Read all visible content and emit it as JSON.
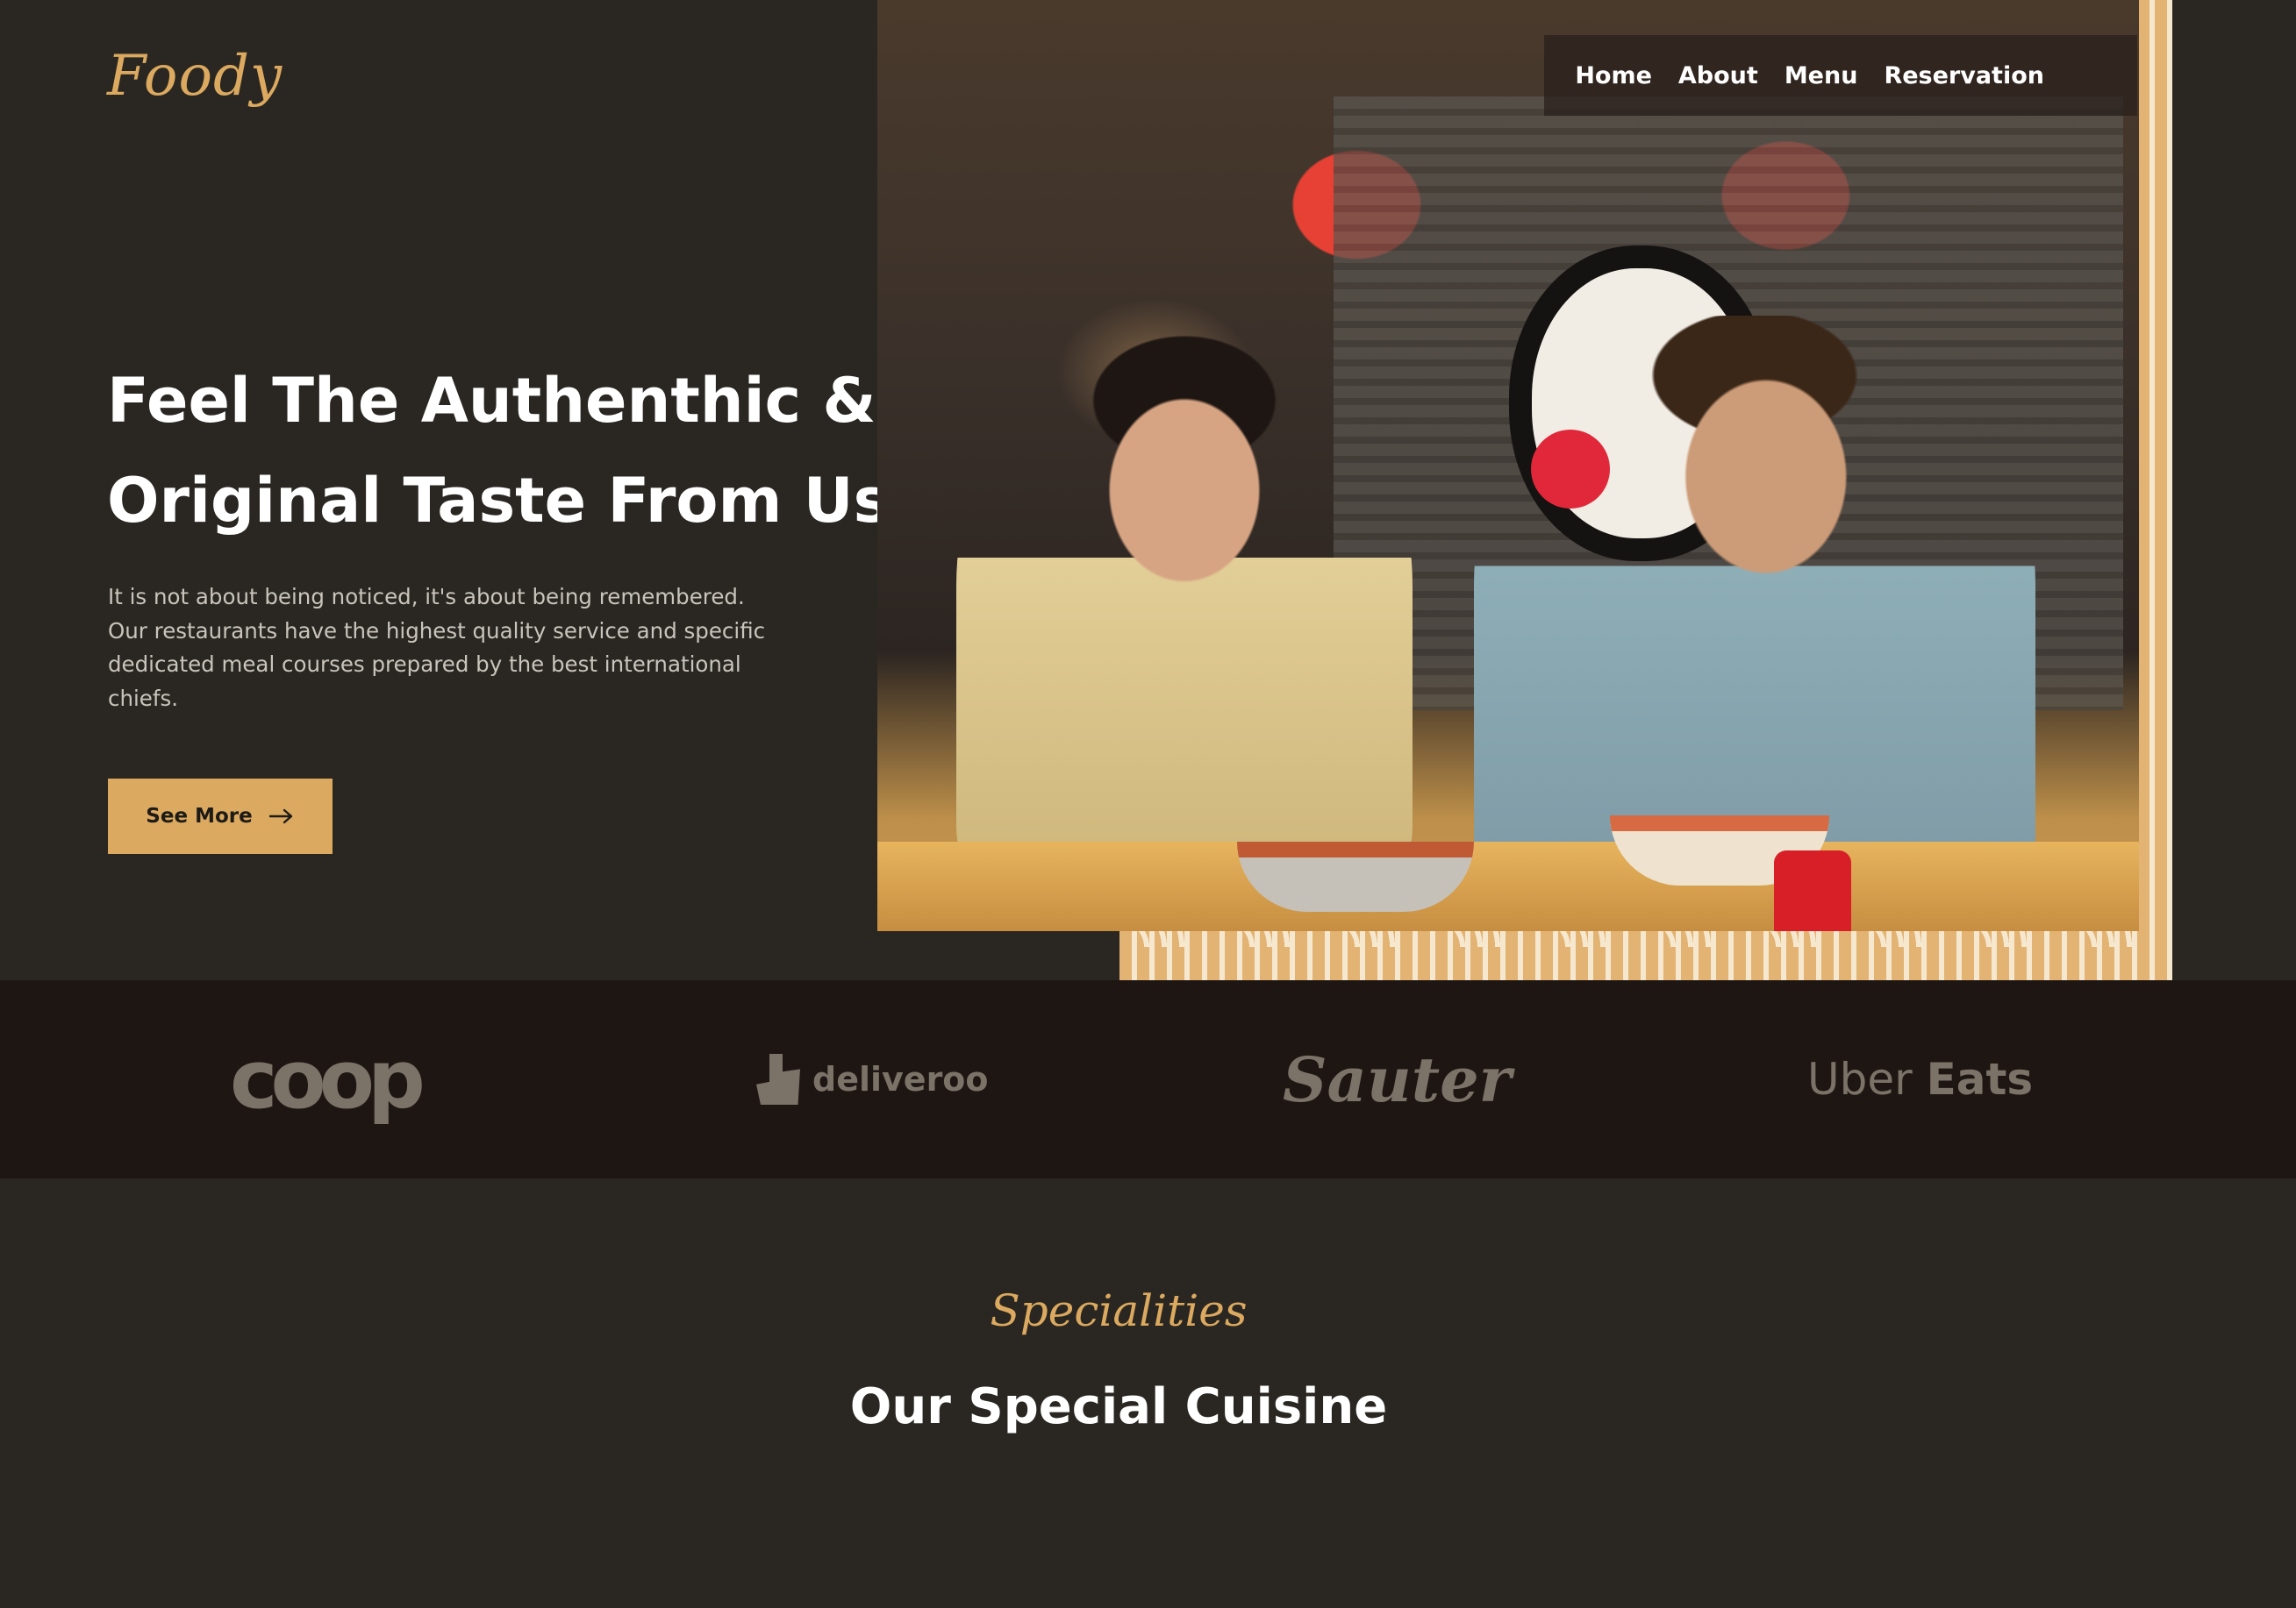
{
  "brand": {
    "logo": "Foody",
    "accent": "#dba95f",
    "background": "#2a2722"
  },
  "nav": {
    "items": [
      "Home",
      "About",
      "Menu",
      "Reservation"
    ]
  },
  "hero": {
    "headline_line1": "Feel The Authenthic &",
    "headline_line2": "Original Taste From Us",
    "lead": "It is not about being noticed, it's about being remembered. Our restaurants have the highest quality service and specific dedicated meal courses prepared by the best international chiefs.",
    "cta_label": "See More",
    "cta_icon": "arrow-right-icon"
  },
  "partners": {
    "coop": "coop",
    "deliveroo": "deliveroo",
    "sauter": "Sauter",
    "uber": "Uber",
    "eats": "Eats"
  },
  "specialities": {
    "eyebrow": "Specialities",
    "title": "Our Special Cuisine"
  }
}
